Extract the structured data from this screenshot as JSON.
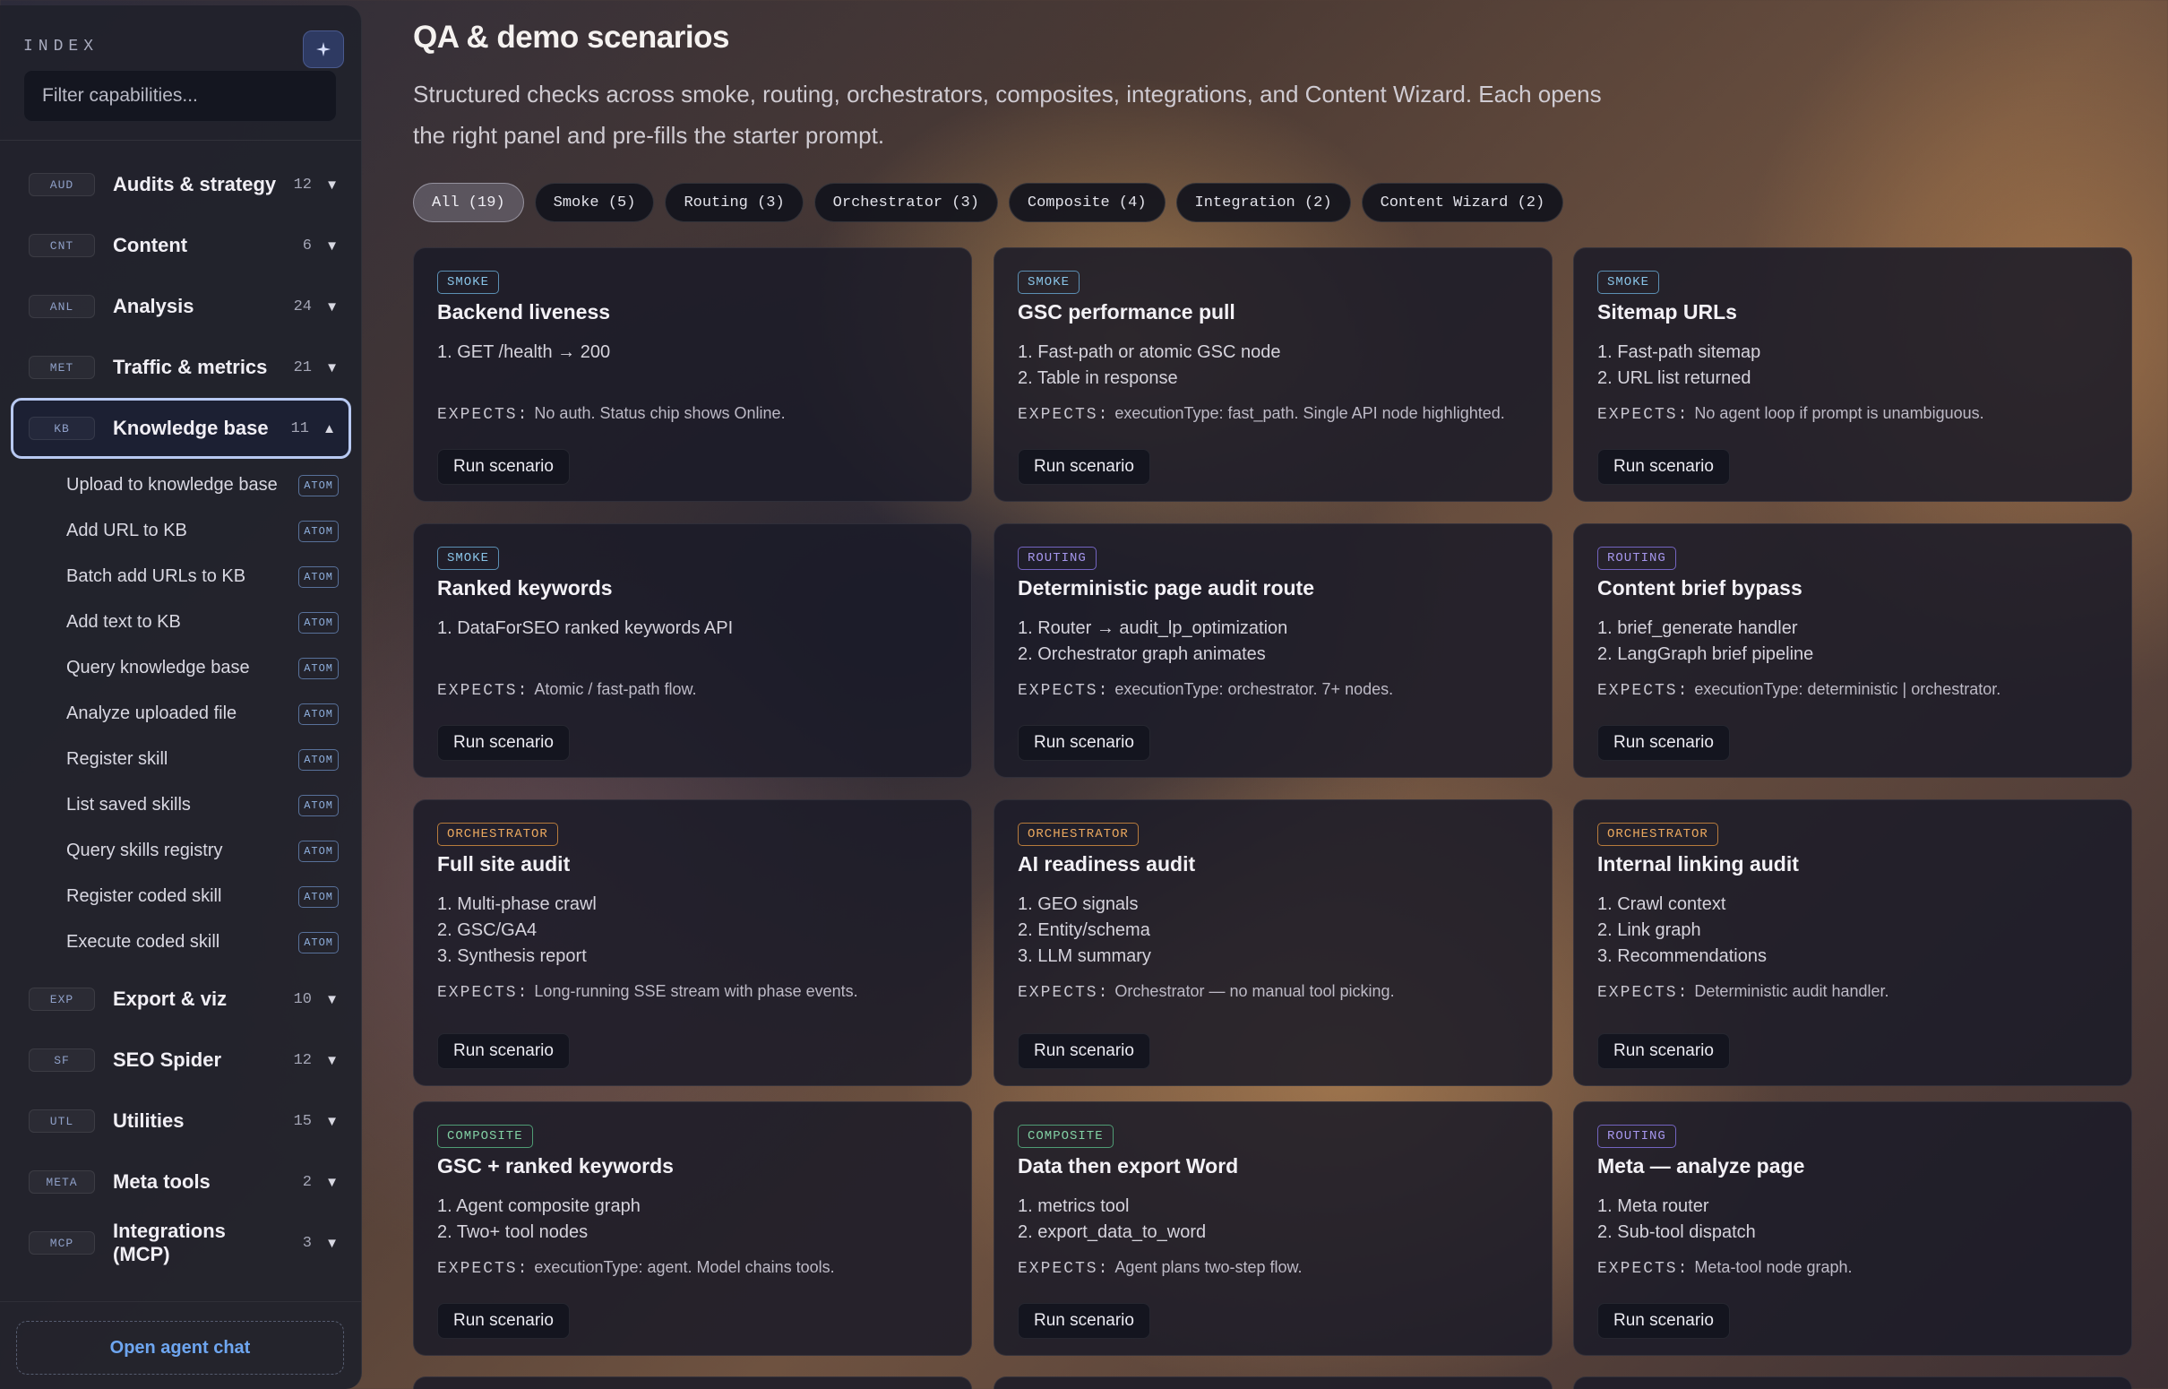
{
  "sidebar": {
    "index_label": "INDEX",
    "add_icon": "sparkle-plus-icon",
    "filter_placeholder": "Filter capabilities...",
    "categories": [
      {
        "tag": "AUD",
        "label": "Audits & strategy",
        "count": "12",
        "expanded": false
      },
      {
        "tag": "CNT",
        "label": "Content",
        "count": "6",
        "expanded": false
      },
      {
        "tag": "ANL",
        "label": "Analysis",
        "count": "24",
        "expanded": false
      },
      {
        "tag": "MET",
        "label": "Traffic & metrics",
        "count": "21",
        "expanded": false
      },
      {
        "tag": "KB",
        "label": "Knowledge base",
        "count": "11",
        "expanded": true
      },
      {
        "tag": "EXP",
        "label": "Export & viz",
        "count": "10",
        "expanded": false
      },
      {
        "tag": "SF",
        "label": "SEO Spider",
        "count": "12",
        "expanded": false
      },
      {
        "tag": "UTL",
        "label": "Utilities",
        "count": "15",
        "expanded": false
      },
      {
        "tag": "META",
        "label": "Meta tools",
        "count": "2",
        "expanded": false
      },
      {
        "tag": "MCP",
        "label": "Integrations (MCP)",
        "count": "3",
        "expanded": false
      }
    ],
    "kb_items": [
      {
        "label": "Upload to knowledge base",
        "badge": "ATOM"
      },
      {
        "label": "Add URL to KB",
        "badge": "ATOM"
      },
      {
        "label": "Batch add URLs to KB",
        "badge": "ATOM"
      },
      {
        "label": "Add text to KB",
        "badge": "ATOM"
      },
      {
        "label": "Query knowledge base",
        "badge": "ATOM"
      },
      {
        "label": "Analyze uploaded file",
        "badge": "ATOM"
      },
      {
        "label": "Register skill",
        "badge": "ATOM"
      },
      {
        "label": "List saved skills",
        "badge": "ATOM"
      },
      {
        "label": "Query skills registry",
        "badge": "ATOM"
      },
      {
        "label": "Register coded skill",
        "badge": "ATOM"
      },
      {
        "label": "Execute coded skill",
        "badge": "ATOM"
      }
    ],
    "open_chat": "Open agent chat"
  },
  "main": {
    "title": "QA & demo scenarios",
    "description": "Structured checks across smoke, routing, orchestrators, composites, integrations, and Content Wizard. Each opens the right panel and pre-fills the starter prompt.",
    "filters": [
      {
        "label": "All (19)",
        "active": true
      },
      {
        "label": "Smoke (5)",
        "active": false
      },
      {
        "label": "Routing (3)",
        "active": false
      },
      {
        "label": "Orchestrator (3)",
        "active": false
      },
      {
        "label": "Composite (4)",
        "active": false
      },
      {
        "label": "Integration (2)",
        "active": false
      },
      {
        "label": "Content Wizard (2)",
        "active": false
      }
    ],
    "expects_label": "EXPECTS:",
    "run_label": "Run scenario",
    "cards": [
      {
        "badge": "SMOKE",
        "kind": "smoke",
        "title": "Backend liveness",
        "steps": [
          "1. GET /health → 200"
        ],
        "expects": "No auth. Status chip shows Online."
      },
      {
        "badge": "SMOKE",
        "kind": "smoke",
        "title": "GSC performance pull",
        "steps": [
          "1. Fast-path or atomic GSC node",
          "2. Table in response"
        ],
        "expects": "executionType: fast_path. Single API node highlighted."
      },
      {
        "badge": "SMOKE",
        "kind": "smoke",
        "title": "Sitemap URLs",
        "steps": [
          "1. Fast-path sitemap",
          "2. URL list returned"
        ],
        "expects": "No agent loop if prompt is unambiguous."
      },
      {
        "badge": "SMOKE",
        "kind": "smoke",
        "title": "Ranked keywords",
        "steps": [
          "1. DataForSEO ranked keywords API"
        ],
        "expects": "Atomic / fast-path flow."
      },
      {
        "badge": "ROUTING",
        "kind": "routing",
        "title": "Deterministic page audit route",
        "steps": [
          "1. Router → audit_lp_optimization",
          "2. Orchestrator graph animates"
        ],
        "expects": "executionType: orchestrator. 7+ nodes."
      },
      {
        "badge": "ROUTING",
        "kind": "routing",
        "title": "Content brief bypass",
        "steps": [
          "1. brief_generate handler",
          "2. LangGraph brief pipeline"
        ],
        "expects": "executionType: deterministic | orchestrator."
      },
      {
        "badge": "ORCHESTRATOR",
        "kind": "orch",
        "title": "Full site audit",
        "steps": [
          "1. Multi-phase crawl",
          "2. GSC/GA4",
          "3. Synthesis report"
        ],
        "expects": "Long-running SSE stream with phase events."
      },
      {
        "badge": "ORCHESTRATOR",
        "kind": "orch",
        "title": "AI readiness audit",
        "steps": [
          "1. GEO signals",
          "2. Entity/schema",
          "3. LLM summary"
        ],
        "expects": "Orchestrator — no manual tool picking."
      },
      {
        "badge": "ORCHESTRATOR",
        "kind": "orch",
        "title": "Internal linking audit",
        "steps": [
          "1. Crawl context",
          "2. Link graph",
          "3. Recommendations"
        ],
        "expects": "Deterministic audit handler."
      },
      {
        "badge": "COMPOSITE",
        "kind": "comp",
        "title": "GSC + ranked keywords",
        "steps": [
          "1. Agent composite graph",
          "2. Two+ tool nodes"
        ],
        "expects": "executionType: agent. Model chains tools."
      },
      {
        "badge": "COMPOSITE",
        "kind": "comp",
        "title": "Data then export Word",
        "steps": [
          "1. metrics tool",
          "2. export_data_to_word"
        ],
        "expects": "Agent plans two-step flow."
      },
      {
        "badge": "ROUTING",
        "kind": "routing",
        "title": "Meta — analyze page",
        "steps": [
          "1. Meta router",
          "2. Sub-tool dispatch"
        ],
        "expects": "Meta-tool node graph."
      }
    ]
  }
}
